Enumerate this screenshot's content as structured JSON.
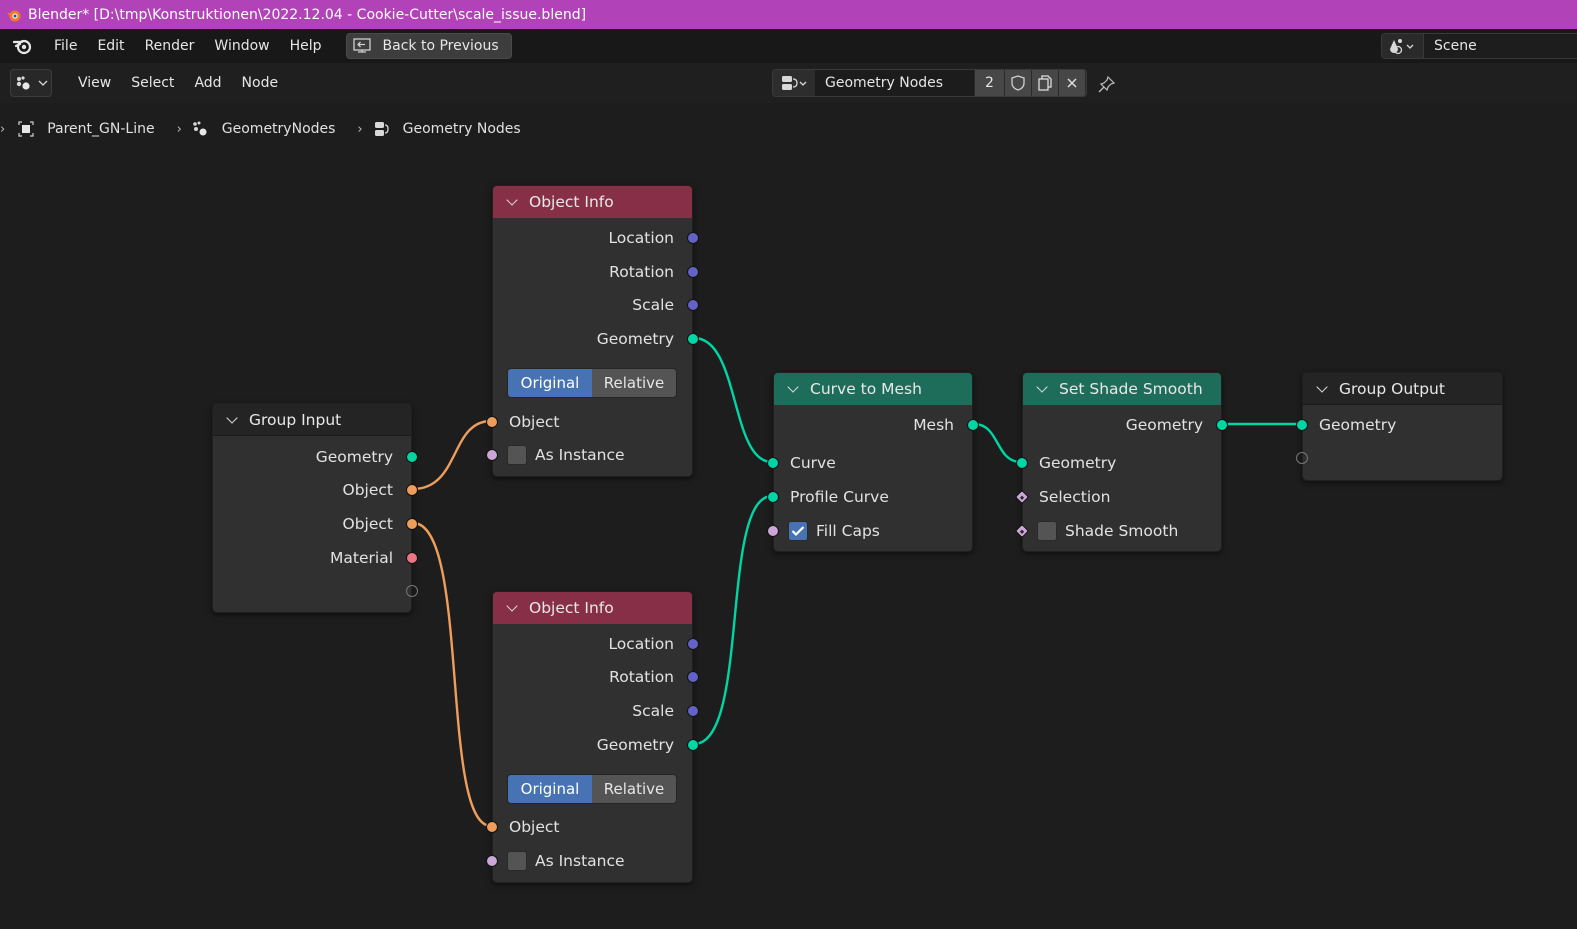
{
  "window": {
    "title": "Blender* [D:\\tmp\\Konstruktionen\\2022.12.04 - Cookie-Cutter\\scale_issue.blend]",
    "titlebar_color": "#b142b7"
  },
  "topbar": {
    "menus": [
      "File",
      "Edit",
      "Render",
      "Window",
      "Help"
    ],
    "back_button": "Back to Previous",
    "scene": "Scene"
  },
  "editor_header": {
    "menus": [
      "View",
      "Select",
      "Add",
      "Node"
    ],
    "node_group": {
      "name": "Geometry Nodes",
      "users": "2"
    }
  },
  "breadcrumb": {
    "items": [
      "Parent_GN-Line",
      "GeometryNodes",
      "Geometry Nodes"
    ]
  },
  "colors": {
    "geometry_socket": "#00d6a3",
    "vector_socket": "#6363c7",
    "object_socket": "#ed9e5c",
    "boolean_socket": "#cca6d6",
    "material_socket": "#eb7582",
    "geometry_header": "#1e6d5a",
    "input_header": "#882f48",
    "accent": "#4772b3"
  },
  "nodes": {
    "group_input": {
      "title": "Group Input",
      "outputs": [
        "Geometry",
        "Object",
        "Object",
        "Material"
      ]
    },
    "object_info_1": {
      "title": "Object Info",
      "outputs": [
        "Location",
        "Rotation",
        "Scale",
        "Geometry"
      ],
      "mode_options": [
        "Original",
        "Relative"
      ],
      "mode_selected": "Original",
      "inputs": [
        "Object"
      ],
      "as_instance_label": "As Instance",
      "as_instance_checked": false
    },
    "object_info_2": {
      "title": "Object Info",
      "outputs": [
        "Location",
        "Rotation",
        "Scale",
        "Geometry"
      ],
      "mode_options": [
        "Original",
        "Relative"
      ],
      "mode_selected": "Original",
      "inputs": [
        "Object"
      ],
      "as_instance_label": "As Instance",
      "as_instance_checked": false
    },
    "curve_to_mesh": {
      "title": "Curve to Mesh",
      "outputs": [
        "Mesh"
      ],
      "inputs": [
        "Curve",
        "Profile Curve"
      ],
      "fill_caps_label": "Fill Caps",
      "fill_caps_checked": true
    },
    "set_shade_smooth": {
      "title": "Set Shade Smooth",
      "outputs": [
        "Geometry"
      ],
      "inputs": [
        "Geometry",
        "Selection"
      ],
      "shade_smooth_label": "Shade Smooth",
      "shade_smooth_checked": false
    },
    "group_output": {
      "title": "Group Output",
      "inputs": [
        "Geometry"
      ]
    }
  }
}
